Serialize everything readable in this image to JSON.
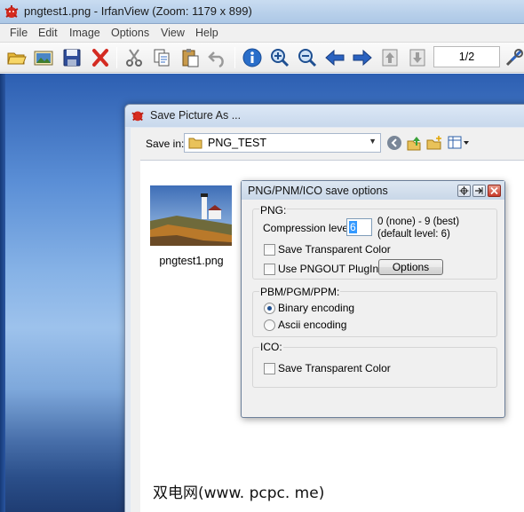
{
  "window": {
    "title": "pngtest1.png - IrfanView (Zoom: 1179 x 899)"
  },
  "menu": [
    "File",
    "Edit",
    "Image",
    "Options",
    "View",
    "Help"
  ],
  "toolbar": {
    "buttons": [
      "open-folder-icon",
      "thumbnails-icon",
      "save-icon",
      "delete-icon",
      "cut-icon",
      "copy-icon",
      "paste-icon",
      "undo-icon",
      "info-icon",
      "zoom-in-icon",
      "zoom-out-icon",
      "previous-arrow-icon",
      "next-arrow-icon",
      "previous-page-icon",
      "next-page-icon",
      "tools-icon"
    ],
    "page_counter": "1/2"
  },
  "save_dialog": {
    "title": "Save Picture As ...",
    "save_in_label": "Save in:",
    "save_in_value": "PNG_TEST",
    "files": [
      {
        "name": "pngtest1.png"
      }
    ]
  },
  "png_options": {
    "title": "PNG/PNM/ICO save options",
    "png_group": {
      "label": "PNG:",
      "compression_label": "Compression level:",
      "compression_value": "6",
      "compression_hint_1": "0 (none) - 9 (best)",
      "compression_hint_2": "(default level: 6)",
      "save_transparent": {
        "label": "Save Transparent Color",
        "checked": false
      },
      "use_pngout": {
        "label": "Use PNGOUT PlugIn",
        "checked": false
      },
      "options_button": "Options"
    },
    "pnm_group": {
      "label": "PBM/PGM/PPM:",
      "binary": {
        "label": "Binary encoding",
        "selected": true
      },
      "ascii": {
        "label": "Ascii encoding",
        "selected": false
      }
    },
    "ico_group": {
      "label": "ICO:",
      "save_transparent": {
        "label": "Save Transparent Color",
        "checked": false
      }
    }
  },
  "watermark": "双电网(www. pcpc. me)",
  "colors": {
    "title_bar": "#c9dcf1",
    "selection": "#3399ff",
    "irfanview_red": "#d62b1f"
  }
}
